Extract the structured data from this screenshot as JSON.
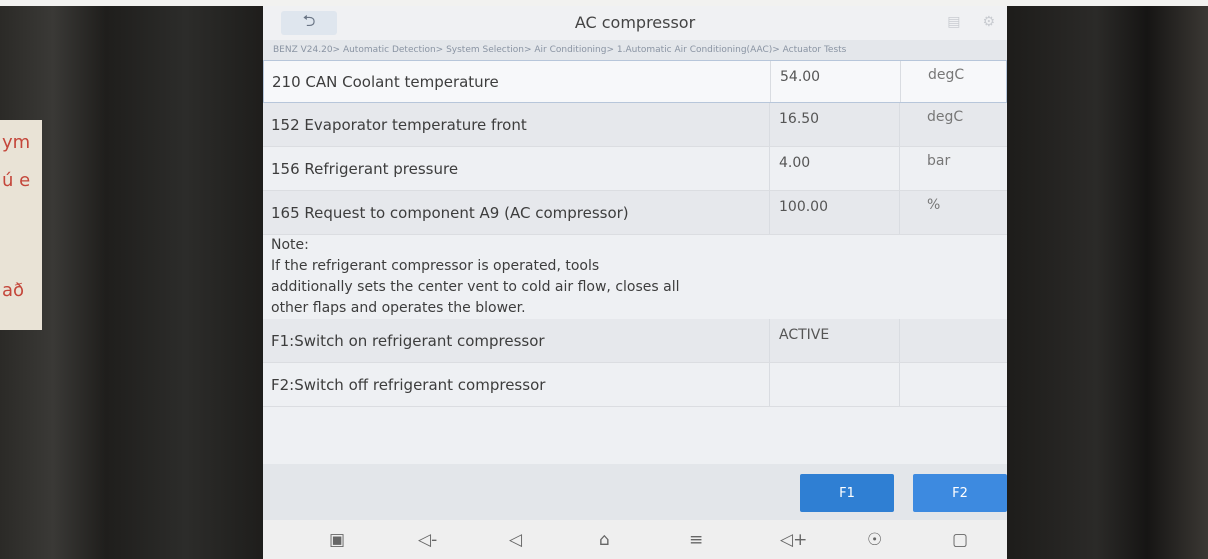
{
  "header": {
    "title": "AC compressor",
    "back_icon": "back-arrow-icon",
    "icons": [
      "chat-icon",
      "settings-icon"
    ]
  },
  "breadcrumb": "BENZ V24.20> Automatic Detection> System Selection> Air Conditioning> 1.Automatic Air Conditioning(AAC)> Actuator Tests",
  "rows": [
    {
      "label": "210 CAN Coolant temperature",
      "value": "54.00",
      "unit": "degC"
    },
    {
      "label": "152 Evaporator temperature front",
      "value": "16.50",
      "unit": "degC"
    },
    {
      "label": "156 Refrigerant pressure",
      "value": "4.00",
      "unit": "bar"
    },
    {
      "label": "165 Request to component A9 (AC compressor)",
      "value": "100.00",
      "unit": "%"
    }
  ],
  "note": {
    "heading": "Note:",
    "line1": "If the refrigerant compressor is operated, tools",
    "line2": "additionally sets the center vent to cold air flow, closes all",
    "line3": "other flaps and operates the blower."
  },
  "functions": [
    {
      "label": "F1:Switch on refrigerant compressor",
      "value": "ACTIVE"
    },
    {
      "label": "F2:Switch off refrigerant compressor",
      "value": ""
    }
  ],
  "buttons": {
    "f1": "F1",
    "f2": "F2"
  },
  "navbar": {
    "icons": [
      "screenshot-icon",
      "volume-down-icon",
      "back-icon",
      "home-icon",
      "menu-icon",
      "volume-up-icon",
      "vci-icon",
      "cast-icon"
    ]
  }
}
